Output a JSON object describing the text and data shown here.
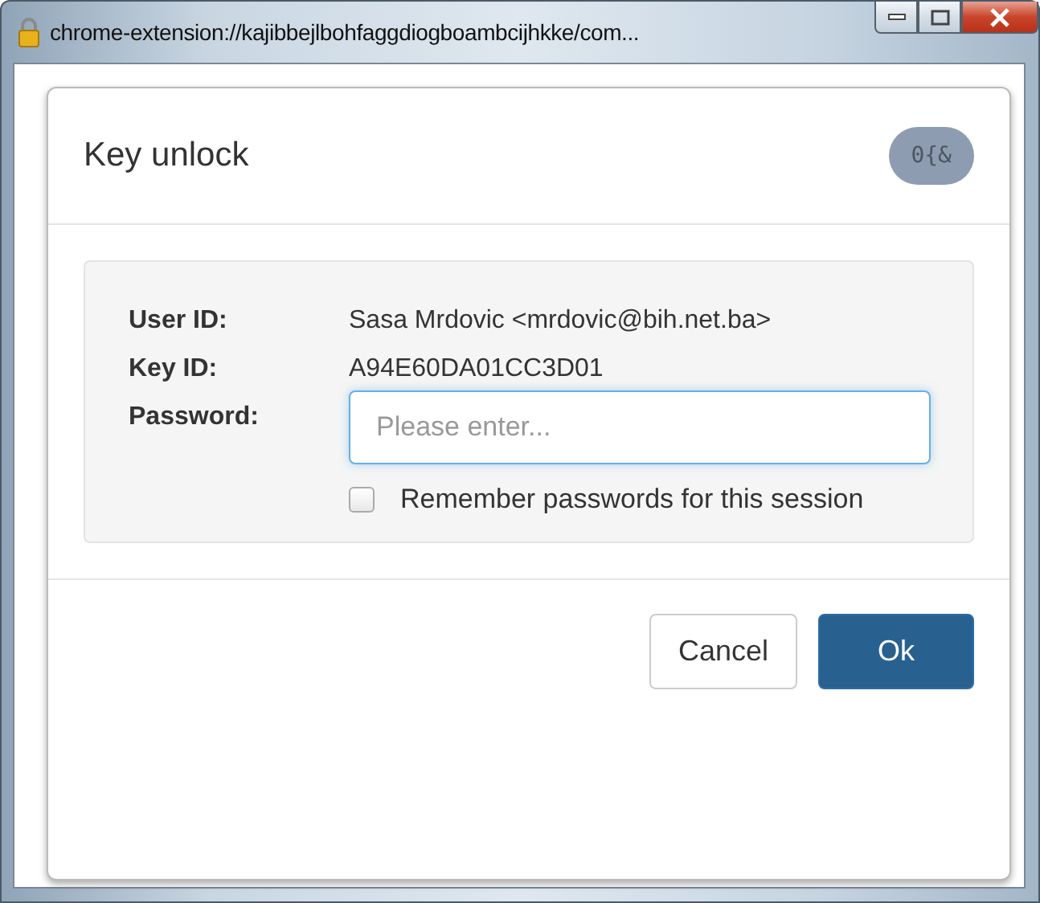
{
  "window": {
    "title": "chrome-extension://kajibbejlbohfaggdiogboambcijhkke/com..."
  },
  "dialog": {
    "title": "Key unlock",
    "badge": "0{&",
    "fields": [
      {
        "label": "User ID:",
        "value": "Sasa Mrdovic <mrdovic@bih.net.ba>"
      },
      {
        "label": "Key ID:",
        "value": "A94E60DA01CC3D01"
      }
    ],
    "password": {
      "label": "Password:",
      "placeholder": "Please enter..."
    },
    "remember": {
      "label": "Remember passwords for this session",
      "checked": false
    },
    "buttons": [
      {
        "label": "Cancel",
        "kind": "secondary"
      },
      {
        "label": "Ok",
        "kind": "primary"
      }
    ]
  }
}
